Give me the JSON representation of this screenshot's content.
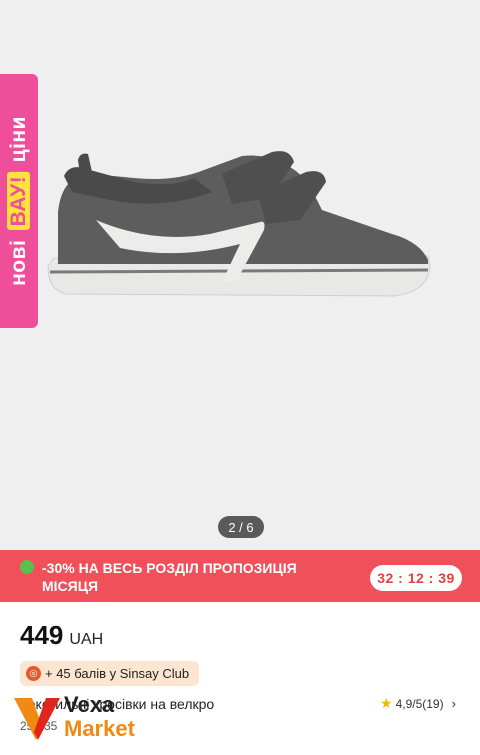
{
  "gallery": {
    "side_badge": {
      "before": "нові",
      "highlight": "ВАУ!",
      "after": "ціни"
    },
    "pager": "2 / 6"
  },
  "promo": {
    "text": "-30% НА ВЕСЬ РОЗДІЛ ПРОПОЗИЦІЯ МІСЯЦЯ",
    "timer": "32 : 12 : 39"
  },
  "product": {
    "price": "449",
    "currency": "UAH",
    "club": "+ 45 балів у Sinsay Club",
    "name": "Текстильні кросівки на велкро",
    "sizes": "25 - 35",
    "rating": "4,9/5(19)"
  },
  "watermark": {
    "line1": "Vexa",
    "line2": "Market"
  },
  "colors": {
    "badge": "#ef4f9a",
    "promo": "#f0505a",
    "timer_text": "#e8413d",
    "club_bg": "#fce6d2",
    "star": "#f5b400"
  }
}
